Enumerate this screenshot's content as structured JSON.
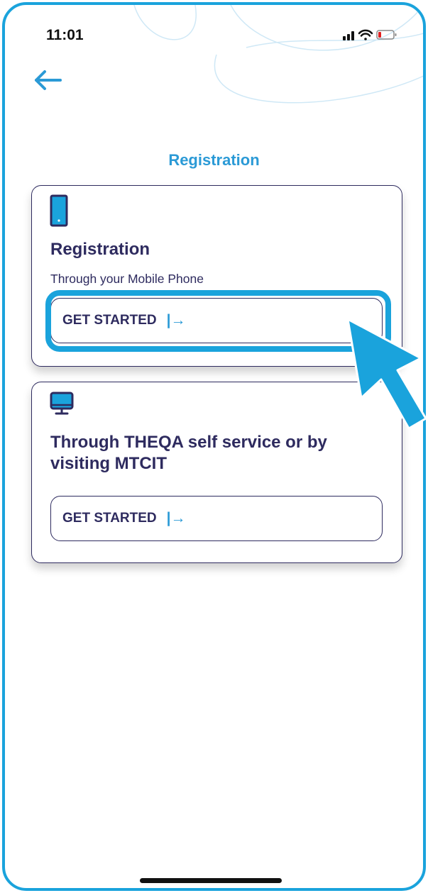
{
  "status_bar": {
    "time": "11:01"
  },
  "header": {
    "back_icon": "arrow-left-icon",
    "title": "Registration"
  },
  "cards": [
    {
      "icon": "mobile-phone-icon",
      "title": "Registration",
      "subtitle": "Through your Mobile Phone",
      "button_label": "GET STARTED",
      "button_icon": "arrow-right-to-bar-icon",
      "highlighted": true
    },
    {
      "icon": "desktop-monitor-icon",
      "title": "Through THEQA self service or by visiting MTCIT",
      "button_label": "GET STARTED",
      "button_icon": "arrow-right-to-bar-icon",
      "highlighted": false
    }
  ],
  "colors": {
    "accent": "#1aa3dc",
    "title_blue": "#2b9ad6",
    "navy": "#2e2b5f"
  }
}
